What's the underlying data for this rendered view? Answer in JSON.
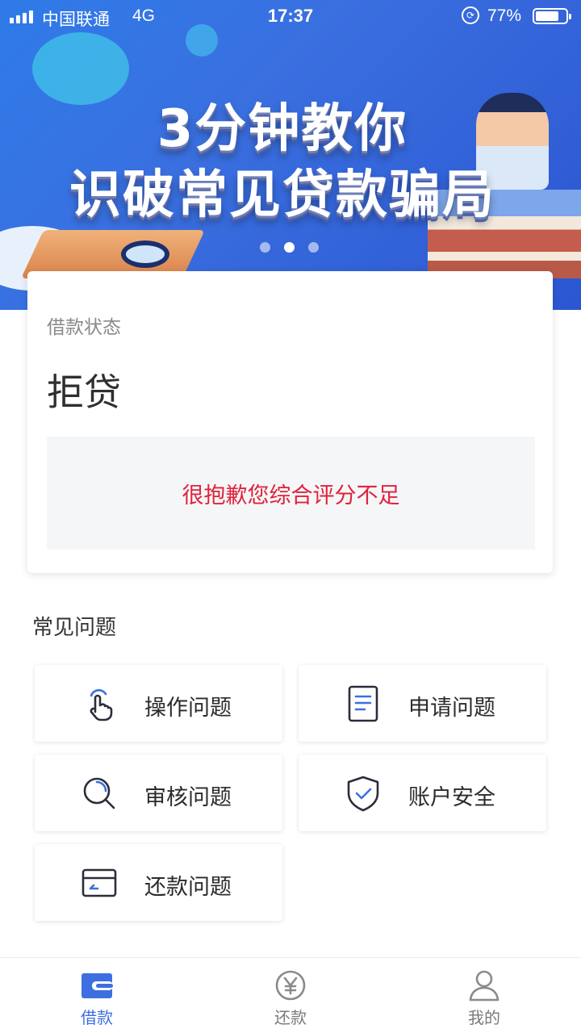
{
  "status_bar": {
    "carrier": "中国联通",
    "network": "4G",
    "time": "17:37",
    "battery_percent": "77%",
    "battery_level": 0.77
  },
  "banner": {
    "title_line1": "3分钟教你",
    "title_line2": "识破常见贷款骗局",
    "page_count": 3,
    "active_page": 2
  },
  "loan_status": {
    "label": "借款状态",
    "value": "拒贷",
    "message": "很抱歉您综合评分不足",
    "message_color": "#e0223b"
  },
  "faq": {
    "title": "常见问题",
    "items": [
      {
        "label": "操作问题",
        "icon": "tap-hand-icon"
      },
      {
        "label": "申请问题",
        "icon": "document-icon"
      },
      {
        "label": "审核问题",
        "icon": "search-icon"
      },
      {
        "label": "账户安全",
        "icon": "shield-check-icon"
      },
      {
        "label": "还款问题",
        "icon": "card-icon"
      }
    ]
  },
  "tabbar": {
    "tabs": [
      {
        "label": "借款",
        "icon": "wallet-icon",
        "active": true
      },
      {
        "label": "还款",
        "icon": "yen-circle-icon",
        "active": false
      },
      {
        "label": "我的",
        "icon": "user-icon",
        "active": false
      }
    ]
  },
  "colors": {
    "accent": "#3d6fe0",
    "error": "#e0223b",
    "icon_dark": "#2b2d3a"
  }
}
